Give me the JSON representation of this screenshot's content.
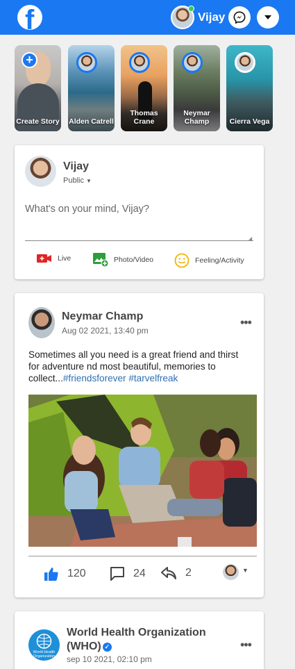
{
  "header": {
    "user_name": "Vijay",
    "colors": {
      "brand": "#1a78f2",
      "online": "#2bd34f"
    },
    "icons": [
      "facebook-logo-icon",
      "messenger-icon",
      "caret-down-icon"
    ]
  },
  "stories": [
    {
      "label": "Create Story"
    },
    {
      "label": "Alden Catrell"
    },
    {
      "label": "Thomas Crane"
    },
    {
      "label": "Neymar Champ"
    },
    {
      "label": "Cierra Vega"
    }
  ],
  "composer": {
    "name": "Vijay",
    "privacy": "Public",
    "placeholder": "What's on your mind, Vijay?",
    "actions": [
      {
        "label": "Live",
        "icon": "video-camera-icon",
        "color": "#e02424"
      },
      {
        "label": "Photo/Video",
        "icon": "photo-add-icon",
        "color": "#2e9d3c"
      },
      {
        "label": "Feeling/Activity",
        "icon": "smiley-icon",
        "color": "#f0b400"
      }
    ]
  },
  "post": {
    "author": "Neymar Champ",
    "time": "Aug 02 2021, 13:40 pm",
    "text": "Sometimes all you need is a great friend and thirst for adventure nd most beautiful, memories to collect...",
    "tags": "#friendsforever #tarvelfreak",
    "likes": "120",
    "comments": "24",
    "shares": "2"
  },
  "post2": {
    "author": "World Health Organization (WHO)",
    "time": "sep 10 2021, 02:10 pm",
    "logo_text": "World Health Organization"
  }
}
